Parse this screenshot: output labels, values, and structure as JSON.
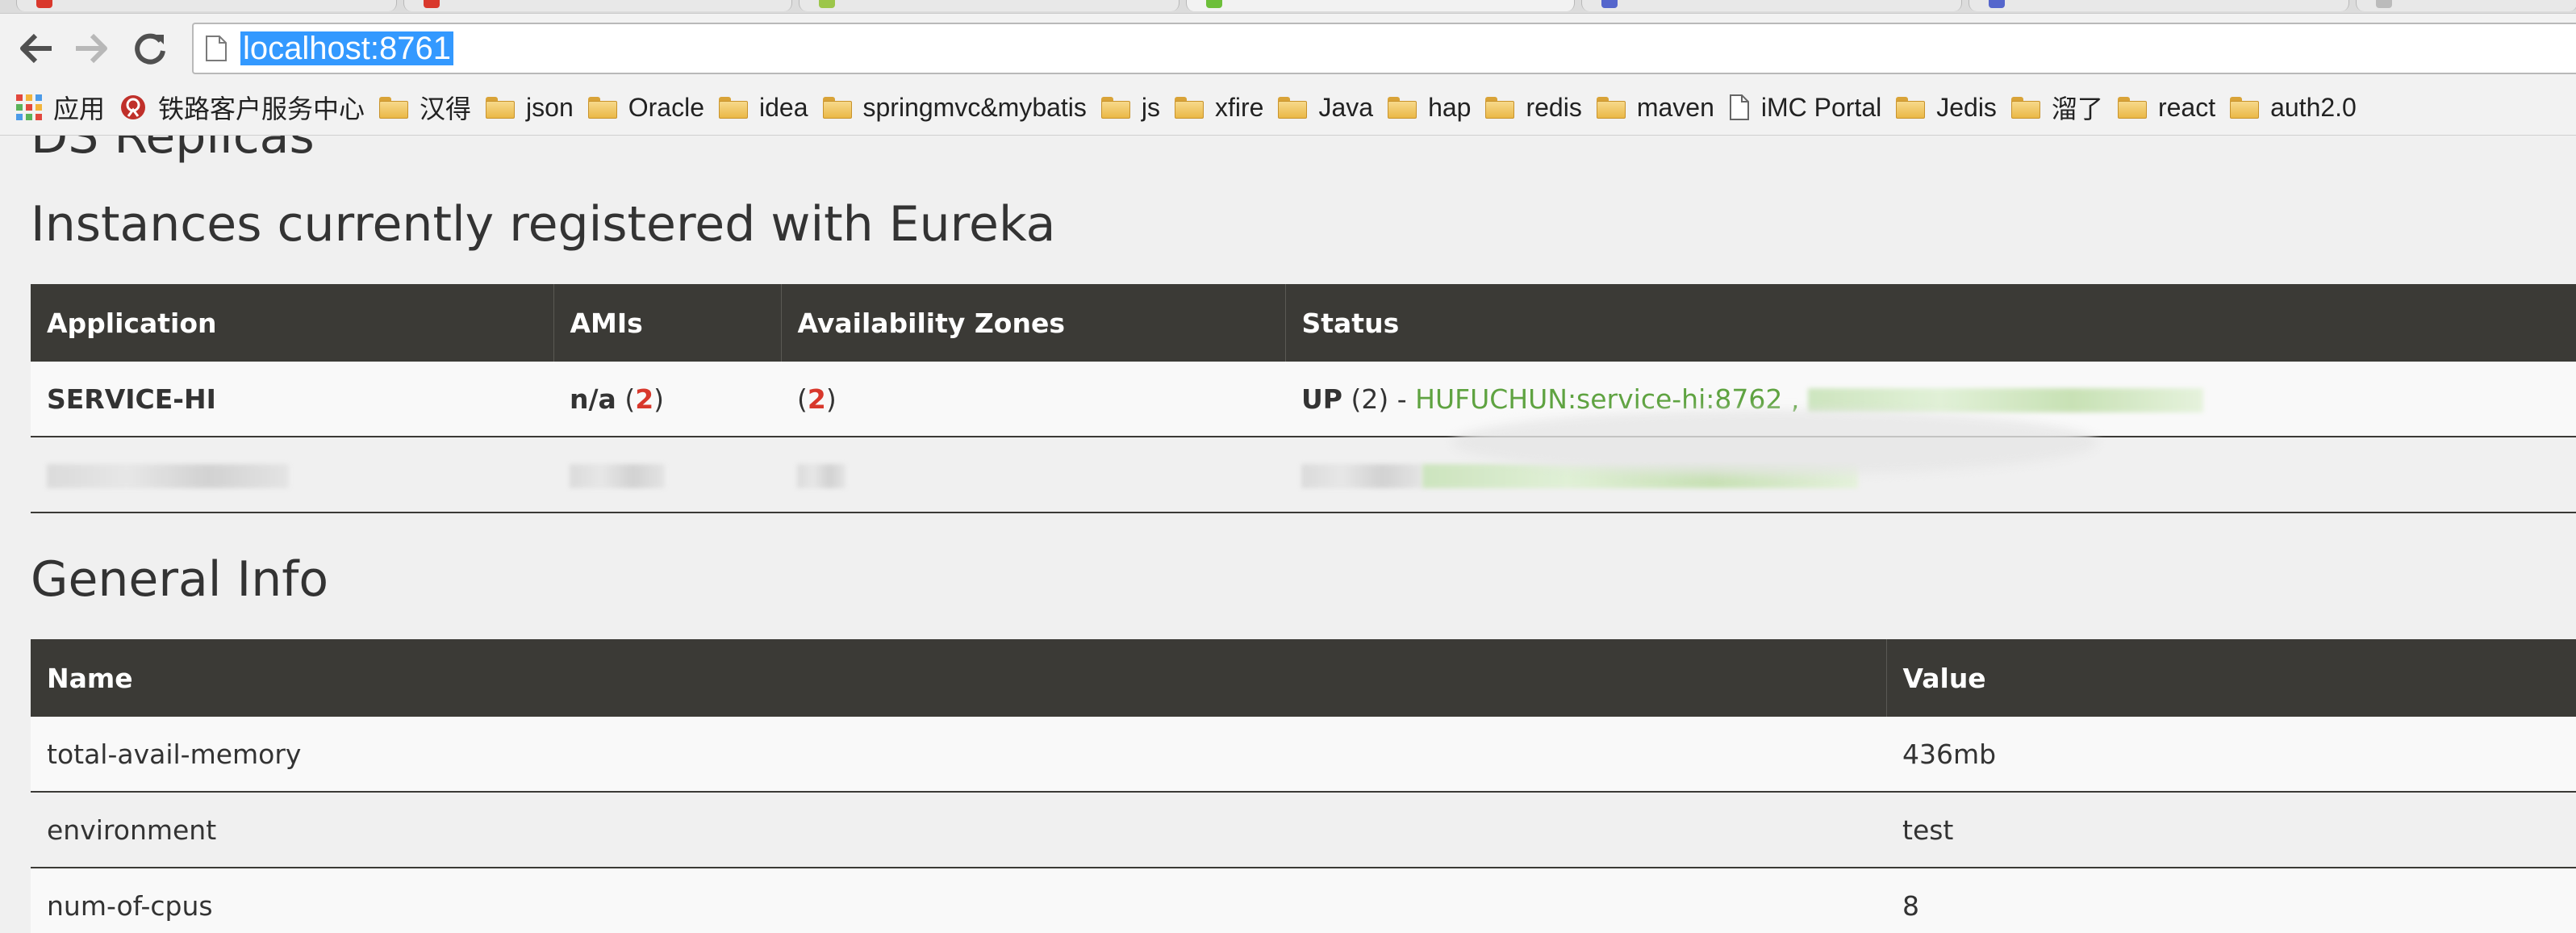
{
  "browser": {
    "url": "localhost:8761",
    "bookmarks": [
      {
        "label": "应用",
        "icon": "apps-grid-icon"
      },
      {
        "label": "铁路客户服务中心",
        "icon": "railway-icon"
      },
      {
        "label": "汉得",
        "icon": "folder-icon"
      },
      {
        "label": "json",
        "icon": "folder-icon"
      },
      {
        "label": "Oracle",
        "icon": "folder-icon"
      },
      {
        "label": "idea",
        "icon": "folder-icon"
      },
      {
        "label": "springmvc&mybatis",
        "icon": "folder-icon"
      },
      {
        "label": "js",
        "icon": "folder-icon"
      },
      {
        "label": "xfire",
        "icon": "folder-icon"
      },
      {
        "label": "Java",
        "icon": "folder-icon"
      },
      {
        "label": "hap",
        "icon": "folder-icon"
      },
      {
        "label": "redis",
        "icon": "folder-icon"
      },
      {
        "label": "maven",
        "icon": "folder-icon"
      },
      {
        "label": "iMC Portal",
        "icon": "page-icon"
      },
      {
        "label": "Jedis",
        "icon": "folder-icon"
      },
      {
        "label": "溜了",
        "icon": "folder-icon"
      },
      {
        "label": "react",
        "icon": "folder-icon"
      },
      {
        "label": "auth2.0",
        "icon": "folder-icon"
      }
    ]
  },
  "page": {
    "cut_heading": "DS Replicas",
    "instances": {
      "title": "Instances currently registered with Eureka",
      "headers": [
        "Application",
        "AMIs",
        "Availability Zones",
        "Status"
      ],
      "rows": [
        {
          "application": "SERVICE-HI",
          "ami_label": "n/a",
          "ami_count_open": "(",
          "ami_count": "2",
          "ami_count_close": ")",
          "zones_open": "(",
          "zones_count": "2",
          "zones_close": ")",
          "status_state": "UP",
          "status_count": "(2) -",
          "status_link": "HUFUCHUN:service-hi:8762",
          "status_sep": ","
        }
      ]
    },
    "general_info": {
      "title": "General Info",
      "headers": [
        "Name",
        "Value"
      ],
      "rows": [
        {
          "name": "total-avail-memory",
          "value": "436mb"
        },
        {
          "name": "environment",
          "value": "test"
        },
        {
          "name": "num-of-cpus",
          "value": "8"
        }
      ]
    }
  },
  "colors": {
    "table_header_bg": "#3b3a36",
    "status_link": "#5fa341",
    "url_highlight": "#3399ff",
    "annotation_red": "#d8382c"
  }
}
